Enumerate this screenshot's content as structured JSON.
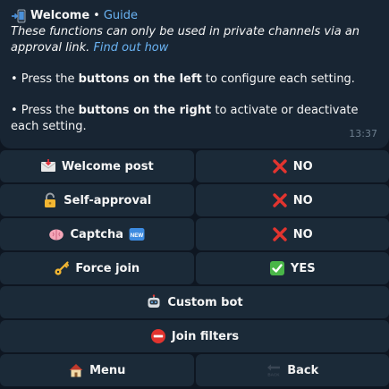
{
  "message": {
    "title": "Welcome",
    "separator": "•",
    "guide_link": "Guide",
    "intro_text": "These functions can only be used in private channels via an approval link.",
    "find_out_link": "Find out how",
    "para1": {
      "prefix": "• Press the ",
      "bold": "buttons on the left",
      "suffix": " to configure each setting."
    },
    "para2": {
      "prefix": "• Press the ",
      "bold": "buttons on the right",
      "suffix": " to activate or deactivate each setting."
    },
    "time": "13:37"
  },
  "keyboard": {
    "rows": [
      {
        "left": "Welcome post",
        "right": "NO",
        "left_icon": "envelope-icon",
        "right_icon": "cross-mark-icon"
      },
      {
        "left": "Self-approval",
        "right": "NO",
        "left_icon": "lock-icon",
        "right_icon": "cross-mark-icon"
      },
      {
        "left": "Captcha",
        "right": "NO",
        "left_icon": "brain-icon",
        "right_icon": "cross-mark-icon",
        "left_badge": "NEW"
      },
      {
        "left": "Force join",
        "right": "YES",
        "left_icon": "key-icon",
        "right_icon": "check-mark-icon"
      }
    ],
    "custom_bot": "Custom bot",
    "join_filters": "Join filters",
    "menu": "Menu",
    "back": "Back"
  }
}
